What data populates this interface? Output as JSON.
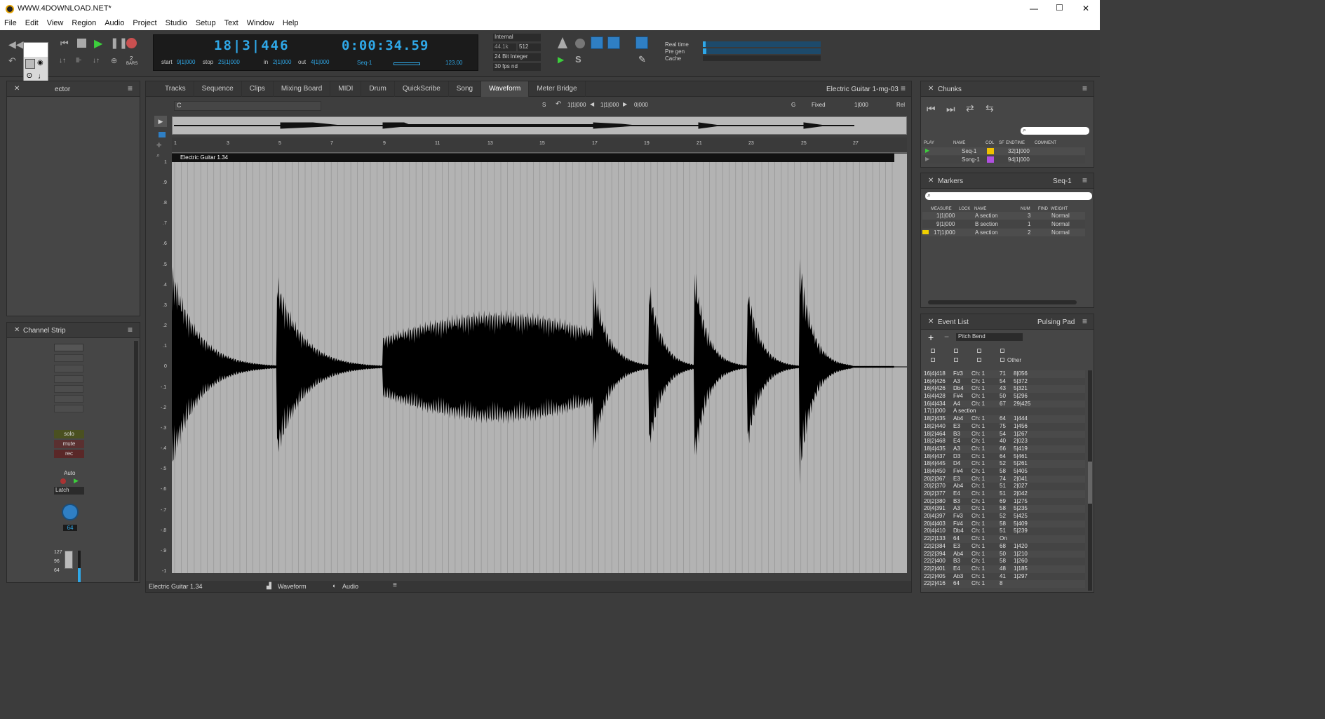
{
  "window": {
    "title": "WWW.4DOWNLOAD.NET*",
    "min": "—",
    "max": "☐",
    "close": "✕"
  },
  "menu": [
    "File",
    "Edit",
    "View",
    "Region",
    "Audio",
    "Project",
    "Studio",
    "Setup",
    "Text",
    "Window",
    "Help"
  ],
  "transport": {
    "counter_main": "18|3|446",
    "counter_time": "0:00:34.59",
    "start_label": "start",
    "start_val": "9|1|000",
    "stop_label": "stop",
    "stop_val": "25|1|000",
    "in_label": "in",
    "in_val": "2|1|000",
    "out_label": "out",
    "out_val": "4|1|000",
    "seq": "Seq-1",
    "tempo": "123.00",
    "bars_num": "2",
    "bars_label": "BARS"
  },
  "sync": {
    "source": "Internal",
    "rate": "44.1k",
    "buffer": "512",
    "bit": "24 Bit Integer",
    "fps": "30 fps nd"
  },
  "meters": {
    "realtime": "Real time",
    "pregen": "Pre gen",
    "cache": "Cache"
  },
  "inspector": {
    "title": "ector"
  },
  "channel_strip": {
    "title": "Channel Strip",
    "solo": "solo",
    "mute": "mute",
    "rec": "rec",
    "auto": "Auto",
    "latch": "Latch",
    "pan": "64",
    "scale": [
      "127",
      "96",
      "64"
    ]
  },
  "tabs": [
    "Tracks",
    "Sequence",
    "Clips",
    "Mixing Board",
    "MIDI",
    "Drum",
    "QuickScribe",
    "Song",
    "Waveform",
    "Meter Bridge"
  ],
  "active_tab": "Waveform",
  "track_title": "Electric Guitar 1-mg-03",
  "waveform": {
    "field_c": "C",
    "s": "S",
    "pos1": "1|1|000",
    "pos2": "1|1|000",
    "pos3": "0|000",
    "g": "G",
    "fixed": "Fixed",
    "grid": "1|000",
    "rel": "Rel",
    "region": "Electric Guitar 1.34",
    "ruler": [
      "1",
      "3",
      "5",
      "7",
      "9",
      "11",
      "13",
      "15",
      "17",
      "19",
      "21",
      "23",
      "25",
      "27"
    ],
    "amp": [
      ".9",
      ".8",
      ".7",
      ".6",
      ".5",
      ".4",
      ".3",
      ".2",
      ".1",
      "0",
      "-.1",
      "-.2",
      "-.3",
      "-.4",
      "-.5",
      "-.6",
      "-.7",
      "-.8",
      "-.9",
      "-1"
    ],
    "amp_top": "1"
  },
  "bottom_bar": {
    "region": "Electric Guitar 1.34",
    "view": "Waveform",
    "audio": "Audio"
  },
  "chunks": {
    "title": "Chunks",
    "headers": [
      "PLAY",
      "NAME",
      "COL",
      "SF",
      "ENDTIME",
      "COMMENT"
    ],
    "rows": [
      {
        "name": "Seq-1",
        "end": "32|1|000",
        "color": "#f0c000"
      },
      {
        "name": "Song-1",
        "end": "94|1|000",
        "color": "#b050e0"
      }
    ]
  },
  "markers": {
    "title": "Markers",
    "seq": "Seq-1",
    "headers": [
      "MEASURE",
      "LOCK",
      "NAME",
      "NUM",
      "FIND",
      "WEIGHT"
    ],
    "rows": [
      {
        "m": "1|1|000",
        "n": "A section",
        "num": "3",
        "w": "Normal"
      },
      {
        "m": "9|1|000",
        "n": "B section",
        "num": "1",
        "w": "Normal"
      },
      {
        "m": "17|1|000",
        "n": "A section",
        "num": "2",
        "w": "Normal"
      }
    ]
  },
  "event_list": {
    "title": "Event List",
    "target": "Pulsing Pad",
    "filter": "Pitch Bend",
    "other": "Other",
    "rows": [
      [
        "16|4|418",
        "F#3",
        "Ch: 1",
        "71",
        "8|056"
      ],
      [
        "16|4|426",
        "A3",
        "Ch: 1",
        "54",
        "5|372"
      ],
      [
        "16|4|426",
        "Db4",
        "Ch: 1",
        "43",
        "5|321"
      ],
      [
        "16|4|428",
        "F#4",
        "Ch: 1",
        "50",
        "5|296"
      ],
      [
        "16|4|434",
        "A4",
        "Ch: 1",
        "67",
        "29|425"
      ],
      [
        "17|1|000",
        "A section",
        "",
        "",
        ""
      ],
      [
        "18|2|435",
        "Ab4",
        "Ch: 1",
        "64",
        "1|444"
      ],
      [
        "18|2|440",
        "E3",
        "Ch: 1",
        "75",
        "1|456"
      ],
      [
        "18|2|464",
        "B3",
        "Ch: 1",
        "54",
        "1|267"
      ],
      [
        "18|2|468",
        "E4",
        "Ch: 1",
        "40",
        "2|023"
      ],
      [
        "18|4|435",
        "A3",
        "Ch: 1",
        "66",
        "5|419"
      ],
      [
        "18|4|437",
        "D3",
        "Ch: 1",
        "64",
        "5|461"
      ],
      [
        "18|4|445",
        "D4",
        "Ch: 1",
        "52",
        "5|261"
      ],
      [
        "18|4|450",
        "F#4",
        "Ch: 1",
        "58",
        "5|405"
      ],
      [
        "20|2|367",
        "E3",
        "Ch: 1",
        "74",
        "2|041"
      ],
      [
        "20|2|370",
        "Ab4",
        "Ch: 1",
        "51",
        "2|027"
      ],
      [
        "20|2|377",
        "E4",
        "Ch: 1",
        "51",
        "2|042"
      ],
      [
        "20|2|380",
        "B3",
        "Ch: 1",
        "69",
        "1|275"
      ],
      [
        "20|4|391",
        "A3",
        "Ch: 1",
        "58",
        "5|235"
      ],
      [
        "20|4|397",
        "F#3",
        "Ch: 1",
        "52",
        "5|425"
      ],
      [
        "20|4|403",
        "F#4",
        "Ch: 1",
        "58",
        "5|409"
      ],
      [
        "20|4|410",
        "Db4",
        "Ch: 1",
        "51",
        "5|239"
      ],
      [
        "22|2|133",
        "64",
        "Ch: 1",
        "On",
        ""
      ],
      [
        "22|2|384",
        "E3",
        "Ch: 1",
        "68",
        "1|420"
      ],
      [
        "22|2|394",
        "Ab4",
        "Ch: 1",
        "50",
        "1|210"
      ],
      [
        "22|2|400",
        "B3",
        "Ch: 1",
        "58",
        "1|260"
      ],
      [
        "22|2|401",
        "E4",
        "Ch: 1",
        "48",
        "1|185"
      ],
      [
        "22|2|405",
        "Ab3",
        "Ch: 1",
        "41",
        "1|297"
      ],
      [
        "22|2|416",
        "64",
        "Ch: 1",
        "8",
        ""
      ]
    ]
  }
}
